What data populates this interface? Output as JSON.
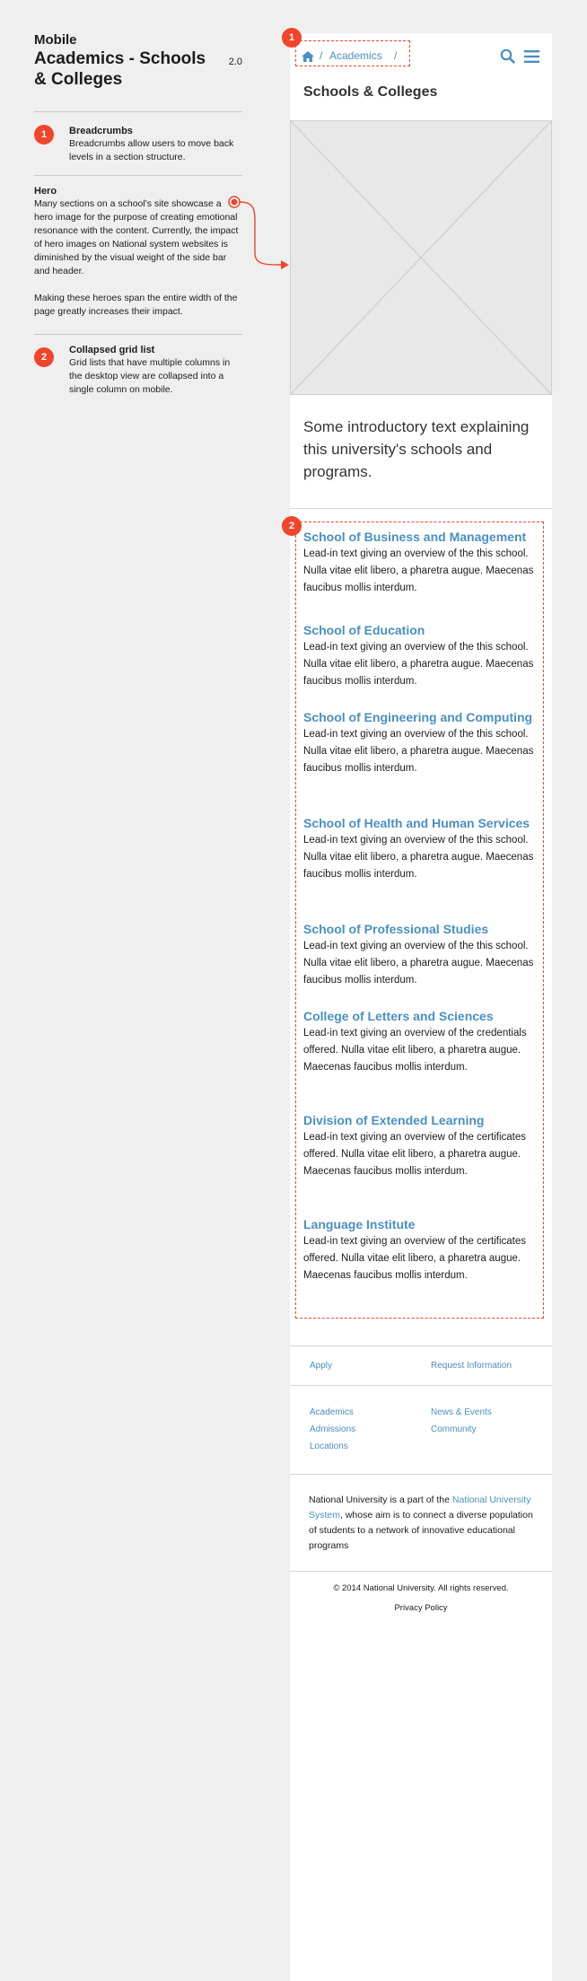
{
  "notes": {
    "kicker": "Mobile",
    "title": "Academics - Schools & Colleges",
    "version": "2.0",
    "items": [
      {
        "badge": "1",
        "heading": "Breadcrumbs",
        "text": "Breadcrumbs allow users to move back levels in a section structure."
      },
      {
        "badge": "",
        "heading": "Hero",
        "text": "Many sections on a school's site showcase a hero image for the purpose of creating emotional resonance with the content. Currently, the impact of hero images on National system websites is diminished by the visual weight of the side bar and header.",
        "text2": "Making these heroes span the entire width of the page greatly increases their impact."
      },
      {
        "badge": "2",
        "heading": "Collapsed grid list",
        "text": "Grid lists that have multiple columns in the desktop view are collapsed into a single column on mobile."
      }
    ]
  },
  "markers": {
    "one": "1",
    "two": "2"
  },
  "mobile": {
    "breadcrumb": {
      "separator": "/",
      "link": "Academics"
    },
    "page_title": "Schools & Colleges",
    "intro": "Some introductory text explaining this university's schools and programs.",
    "schools": [
      {
        "name": "School of Business and Management",
        "text": "Lead-in text giving an overview of the this school. Nulla vitae elit libero, a pharetra augue. Maecenas faucibus mollis interdum."
      },
      {
        "name": "School of Education",
        "text": "Lead-in text giving an overview of the this school. Nulla vitae elit libero, a pharetra augue. Maecenas faucibus mollis interdum."
      },
      {
        "name": "School of Engineering and Computing",
        "text": "Lead-in text giving an overview of the this school. Nulla vitae elit libero, a pharetra augue. Maecenas faucibus mollis interdum."
      },
      {
        "name": "School of Health and Human Services",
        "text": "Lead-in text giving an overview of the this school. Nulla vitae elit libero, a pharetra augue. Maecenas faucibus mollis interdum."
      },
      {
        "name": "School of Professional Studies",
        "text": "Lead-in text giving an overview of the this school. Nulla vitae elit libero, a pharetra augue. Maecenas faucibus mollis interdum."
      },
      {
        "name": "College of Letters and Sciences",
        "text": "Lead-in text giving an overview of the credentials offered. Nulla vitae elit libero, a pharetra augue. Maecenas faucibus mollis interdum."
      },
      {
        "name": "Division of Extended Learning",
        "text": "Lead-in text giving an overview of the certificates offered. Nulla vitae elit libero, a pharetra augue. Maecenas faucibus mollis interdum."
      },
      {
        "name": "Language Institute",
        "text": "Lead-in text giving an overview of the certificates offered. Nulla vitae elit libero, a pharetra augue. Maecenas faucibus mollis interdum."
      }
    ],
    "footer": {
      "cta": [
        "Apply",
        "Request Information"
      ],
      "links": [
        "Academics",
        "News & Events",
        "Admissions",
        "Community",
        "Locations"
      ],
      "about_before": "National University is a part of the ",
      "about_link": "National University System",
      "about_after": ", whose aim is to connect a diverse population of students to a network of innovative educational programs",
      "copyright": "© 2014 National University. All rights reserved.",
      "privacy": "Privacy Policy"
    }
  },
  "colors": {
    "accent": "#f0452b",
    "link": "#4a8fc2",
    "page_bg": "#efefef"
  }
}
